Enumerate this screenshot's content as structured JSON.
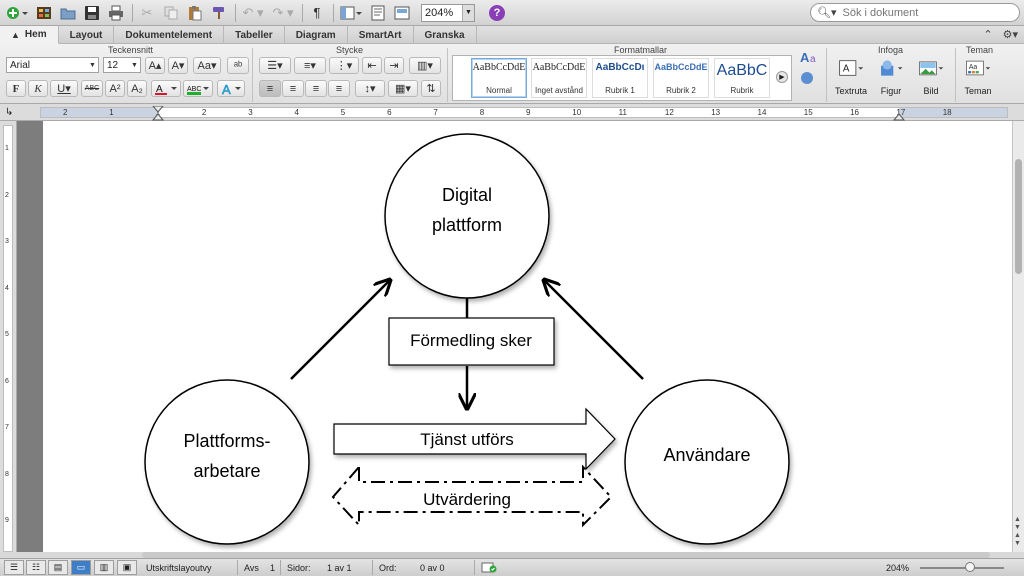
{
  "toolbar": {
    "zoom": "204%",
    "search_placeholder": "Sök i dokument",
    "pilcrow": "¶"
  },
  "tabs": [
    {
      "label": "Hem",
      "active": true
    },
    {
      "label": "Layout"
    },
    {
      "label": "Dokumentelement"
    },
    {
      "label": "Tabeller"
    },
    {
      "label": "Diagram"
    },
    {
      "label": "SmartArt"
    },
    {
      "label": "Granska"
    }
  ],
  "ribbon": {
    "group_font": "Teckensnitt",
    "group_paragraph": "Stycke",
    "group_styles": "Formatmallar",
    "group_insert": "Infoga",
    "group_themes": "Teman",
    "font_name": "Arial",
    "font_size": "12",
    "styles": [
      {
        "sample": "AaBbCcDdE",
        "name": "Normal"
      },
      {
        "sample": "AaBbCcDdE",
        "name": "Inget avstånd"
      },
      {
        "sample": "AaBbCcDı",
        "name": "Rubrik 1"
      },
      {
        "sample": "AaBbCcDdE",
        "name": "Rubrik 2"
      },
      {
        "sample": "AaBbC",
        "name": "Rubrik"
      }
    ],
    "insert_textbox": "Textruta",
    "insert_shape": "Figur",
    "insert_picture": "Bild",
    "themes": "Teman",
    "colors": {
      "font_color": "#d8172d",
      "highlight": "#1fae2d",
      "text_effect": "#2fb6ea"
    }
  },
  "ruler": {
    "numbers": [
      "2",
      "1",
      "1",
      "2",
      "3",
      "4",
      "5",
      "6",
      "7",
      "8",
      "9",
      "10",
      "11",
      "12",
      "13",
      "14",
      "15",
      "16",
      "17",
      "18"
    ],
    "vertical_numbers": [
      "1",
      "2",
      "3",
      "4",
      "5",
      "6",
      "7",
      "8",
      "9"
    ]
  },
  "diagram": {
    "top_circle_line1": "Digital",
    "top_circle_line2": "plattform",
    "left_circle_line1": "Plattforms-",
    "left_circle_line2": "arbetare",
    "right_circle": "Användare",
    "mediation_box": "Förmedling sker",
    "service_arrow": "Tjänst utförs",
    "evaluation": "Utvärdering"
  },
  "statusbar": {
    "view_name": "Utskriftslayoutvy",
    "section_label": "Avs",
    "section_value": "1",
    "pages_label": "Sidor:",
    "pages_value": "1 av 1",
    "words_label": "Ord:",
    "words_value": "0 av 0",
    "zoom": "204%"
  }
}
